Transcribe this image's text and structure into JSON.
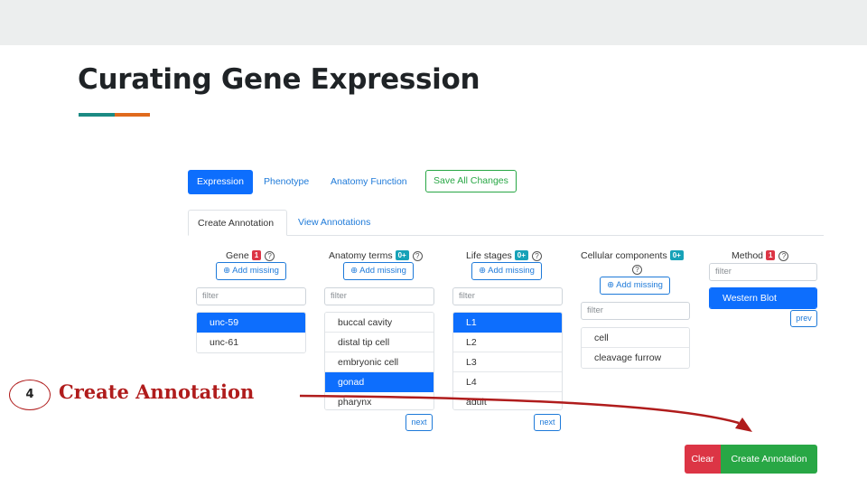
{
  "slide": {
    "title": "Curating Gene Expression",
    "step_number": "4",
    "step_label": "Create Annotation"
  },
  "colors": {
    "accent_teal": "#1b8a83",
    "accent_orange": "#e06a1d",
    "primary": "#0d6efd",
    "success": "#28a745",
    "danger": "#dc3545",
    "annotation_red": "#b01c1c"
  },
  "tabs": {
    "expression": "Expression",
    "phenotype": "Phenotype",
    "anatomy_function": "Anatomy Function",
    "save_all": "Save All Changes"
  },
  "subtabs": {
    "create": "Create Annotation",
    "view": "View Annotations"
  },
  "gene": {
    "label": "Gene",
    "badge": "1",
    "help": "?",
    "add_missing": "⊕ Add missing",
    "filter_placeholder": "filter",
    "items": [
      "unc-59",
      "unc-61"
    ],
    "selected": "unc-59"
  },
  "anatomy": {
    "label": "Anatomy terms",
    "badge": "0+",
    "help": "?",
    "add_missing": "⊕ Add missing",
    "filter_placeholder": "filter",
    "items": [
      "buccal cavity",
      "distal tip cell",
      "embryonic cell",
      "gonad",
      "pharynx"
    ],
    "selected": "gonad",
    "next": "next"
  },
  "life_stages": {
    "label": "Life stages",
    "badge": "0+",
    "help": "?",
    "add_missing": "⊕ Add missing",
    "filter_placeholder": "filter",
    "items": [
      "L1",
      "L2",
      "L3",
      "L4",
      "adult"
    ],
    "selected": "L1",
    "next": "next"
  },
  "cellular": {
    "label": "Cellular components",
    "badge": "0+",
    "help": "?",
    "add_missing": "⊕ Add missing",
    "filter_placeholder": "filter",
    "items": [
      "cell",
      "cleavage furrow"
    ]
  },
  "method": {
    "label": "Method",
    "badge": "1",
    "help": "?",
    "filter_placeholder": "filter",
    "items": [
      "Western Blot"
    ],
    "selected": "Western Blot",
    "prev": "prev"
  },
  "actions": {
    "clear": "Clear",
    "create": "Create Annotation"
  }
}
